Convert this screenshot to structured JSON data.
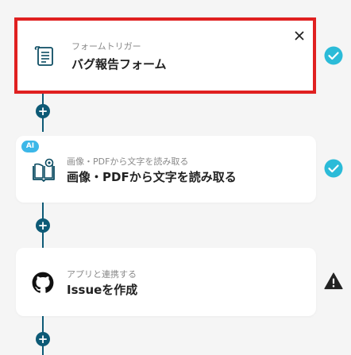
{
  "flow": {
    "steps": [
      {
        "subtitle": "フォームトリガー",
        "title": "バグ報告フォーム",
        "icon": "form-icon",
        "status": "complete",
        "selected": true
      },
      {
        "subtitle": "画像・PDFから文字を読み取る",
        "title": "画像・PDFから文字を読み取る",
        "icon": "ocr-book-icon",
        "badge": "AI",
        "status": "complete"
      },
      {
        "subtitle": "アプリと連携する",
        "title": "Issueを作成",
        "icon": "github-icon",
        "status": "warning"
      }
    ],
    "add_step_label": "+"
  },
  "colors": {
    "selected_border": "#e02020",
    "connector": "#0d5a76",
    "status_complete": "#2bbbd8",
    "status_warning": "#222222",
    "ai_badge": "#3cb7e8"
  }
}
